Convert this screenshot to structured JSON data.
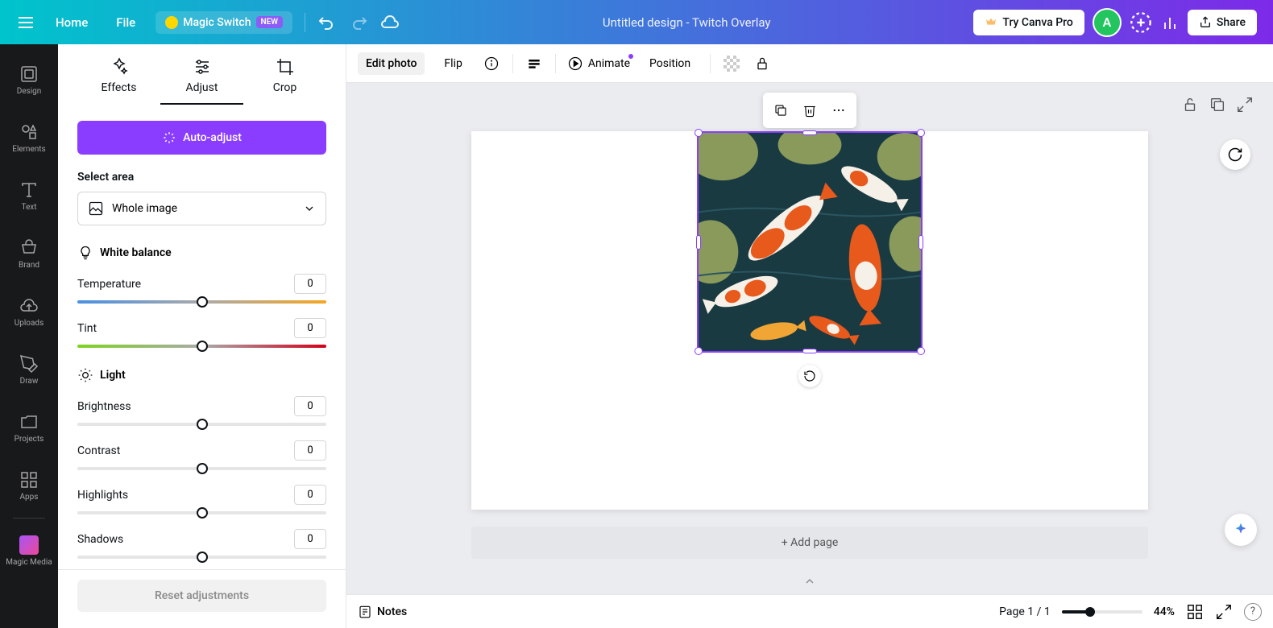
{
  "header": {
    "home_label": "Home",
    "file_label": "File",
    "magic_switch_label": "Magic Switch",
    "new_badge": "NEW",
    "doc_title": "Untitled design - Twitch Overlay",
    "try_pro_label": "Try Canva Pro",
    "avatar_letter": "A",
    "share_label": "Share"
  },
  "sidebar": {
    "items": [
      {
        "label": "Design"
      },
      {
        "label": "Elements"
      },
      {
        "label": "Text"
      },
      {
        "label": "Brand"
      },
      {
        "label": "Uploads"
      },
      {
        "label": "Draw"
      },
      {
        "label": "Projects"
      },
      {
        "label": "Apps"
      }
    ],
    "magic_media_label": "Magic Media"
  },
  "panel": {
    "tabs": {
      "effects_label": "Effects",
      "adjust_label": "Adjust",
      "crop_label": "Crop"
    },
    "auto_adjust_label": "Auto-adjust",
    "select_area_label": "Select area",
    "select_area_value": "Whole image",
    "white_balance_label": "White balance",
    "temperature_label": "Temperature",
    "temperature_value": "0",
    "tint_label": "Tint",
    "tint_value": "0",
    "light_label": "Light",
    "brightness_label": "Brightness",
    "brightness_value": "0",
    "contrast_label": "Contrast",
    "contrast_value": "0",
    "highlights_label": "Highlights",
    "highlights_value": "0",
    "shadows_label": "Shadows",
    "shadows_value": "0",
    "reset_label": "Reset adjustments"
  },
  "toolbar": {
    "edit_photo_label": "Edit photo",
    "flip_label": "Flip",
    "animate_label": "Animate",
    "position_label": "Position"
  },
  "canvas": {
    "add_page_label": "+ Add page"
  },
  "footer": {
    "notes_label": "Notes",
    "page_indicator": "Page 1 / 1",
    "zoom_label": "44%",
    "help_label": "?"
  }
}
